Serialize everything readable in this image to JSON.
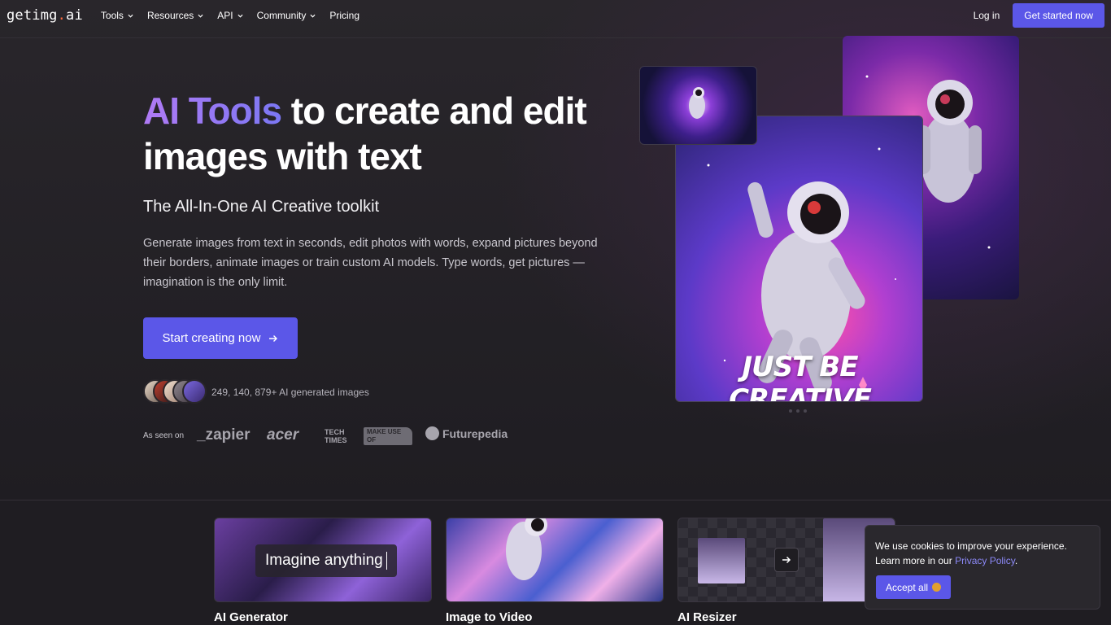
{
  "nav": {
    "logo_main": "getimg",
    "logo_dot": ".",
    "logo_tld": "ai",
    "items": [
      {
        "label": "Tools",
        "has_dropdown": true
      },
      {
        "label": "Resources",
        "has_dropdown": true
      },
      {
        "label": "API",
        "has_dropdown": true
      },
      {
        "label": "Community",
        "has_dropdown": true
      },
      {
        "label": "Pricing",
        "has_dropdown": false
      }
    ],
    "login": "Log in",
    "get_started": "Get started now"
  },
  "hero": {
    "headline_accent": "AI Tools",
    "headline_rest": " to create and edit images with text",
    "subheadline": "The All-In-One AI Creative toolkit",
    "description": "Generate images from text in seconds, edit photos with words, expand pictures beyond their borders, animate images or train custom AI models. Type words, get pictures — imagination is the only limit.",
    "cta": "Start creating now",
    "count_text": "249, 140, 879+ AI generated images",
    "seen_on_label": "As seen on",
    "brands": [
      "_zapier",
      "acer",
      "TECH TIMES",
      "MAKE USE OF",
      "Futurepedia"
    ],
    "art_text": "JUST BE CREATIVE"
  },
  "tools": [
    {
      "title": "AI Generator",
      "overlay": "Imagine anything"
    },
    {
      "title": "Image to Video"
    },
    {
      "title": "AI Resizer"
    }
  ],
  "cookie": {
    "text_before": "We use cookies to improve your experience. Learn more in our ",
    "link": "Privacy Policy",
    "text_after": ".",
    "accept": "Accept all"
  },
  "colors": {
    "accent": "#5b57e8",
    "background": "#1f1d22",
    "logo_dot": "#ff6a3d"
  }
}
